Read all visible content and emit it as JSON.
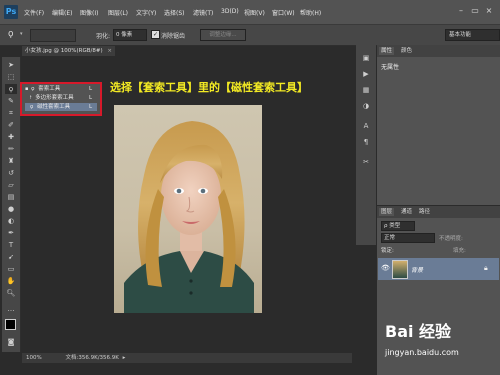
{
  "app": {
    "logo": "Ps"
  },
  "menu": [
    "文件(F)",
    "编辑(E)",
    "图像(I)",
    "图层(L)",
    "文字(Y)",
    "选择(S)",
    "滤镜(T)",
    "3D(D)",
    "视图(V)",
    "窗口(W)",
    "帮助(H)"
  ],
  "window_controls": {
    "minimize": "–",
    "restore": "▭",
    "close": "×"
  },
  "options": {
    "feather_label": "羽化:",
    "feather_value": "0 像素",
    "antialias_label": "消除锯齿",
    "refine_edge": "调整边缘...",
    "workspace": "基本功能"
  },
  "document": {
    "tab_title": "小女孩.jpg @ 100%(RGB/8#)",
    "zoom": "100%",
    "doc_info": "文档:356.9K/356.9K"
  },
  "flyout": {
    "items": [
      {
        "label": "套索工具",
        "shortcut": "L"
      },
      {
        "label": "多边形套索工具",
        "shortcut": "L"
      },
      {
        "label": "磁性套索工具",
        "shortcut": "L"
      }
    ]
  },
  "instruction": "选择【套索工具】里的【磁性套索工具】",
  "properties_panel": {
    "tabs": [
      "属性",
      "颜色"
    ],
    "content": "无属性"
  },
  "layers_panel": {
    "tabs": [
      "图层",
      "通道",
      "路径"
    ],
    "kind_filter": "ρ 类型",
    "blend_mode": "正常",
    "opacity_label": "不透明度:",
    "lock_label": "锁定:",
    "fill_label": "填充:",
    "layer_name": "背景"
  },
  "watermark": {
    "logo": "Bai 经验",
    "url": "jingyan.baidu.com"
  },
  "colors": {
    "accent_red": "#d7192a",
    "instruction_yellow": "#f3ea23",
    "selected_layer": "#6a7c96"
  }
}
